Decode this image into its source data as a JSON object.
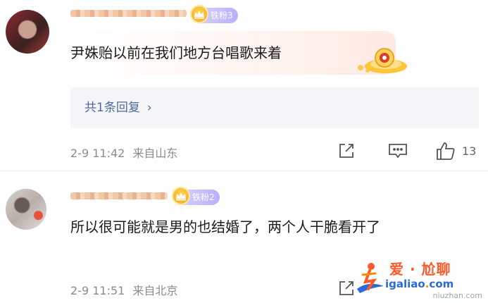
{
  "comments": [
    {
      "badge": "铁粉3",
      "text": "尹姝贻以前在我们地方台唱歌来着",
      "reply_link": "共1条回复",
      "reply_chevron": "›",
      "time": "2-9 11:42",
      "location": "来自山东",
      "likes": "13"
    },
    {
      "badge": "铁粉2",
      "text": "所以很可能就是男的也结婚了，两个人干脆看开了",
      "time": "2-9 11:51",
      "location": "来自北京"
    }
  ],
  "watermark": {
    "title": "爱 · 尬聊",
    "url_prefix": "igaliao",
    "url_dot": ".",
    "url_suffix": "com",
    "subtitle": "niuzhan.com"
  },
  "colors": {
    "link": "#4d6a9c",
    "meta": "#8c8c8c",
    "badge": "#b9b0ff",
    "watermark_title": "#ff5a2a",
    "watermark_url": "#2a6bd8"
  }
}
